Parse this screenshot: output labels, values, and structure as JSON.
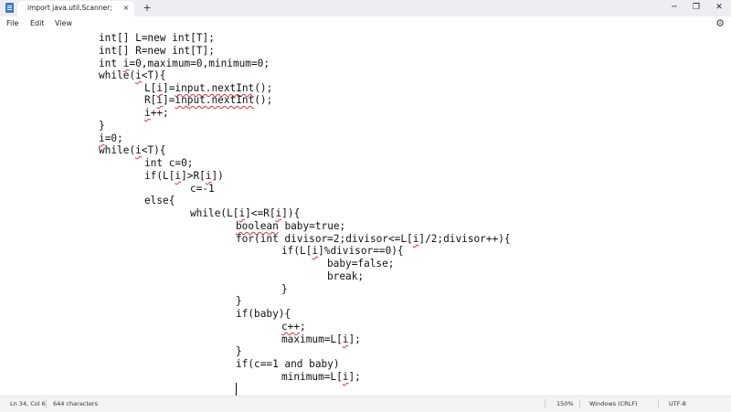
{
  "window": {
    "tab_title": "import java.util.Scanner;",
    "tab_close": "×",
    "new_tab": "+",
    "minimize": "─",
    "maximize": "❐",
    "close": "✕"
  },
  "menu": {
    "file": "File",
    "edit": "Edit",
    "view": "View",
    "settings_icon": "⚙"
  },
  "editor": {
    "lines": [
      "int[] L=new int[T];",
      "int[] R=new int[T];",
      "int i=0,maximum=0,minimum=0;",
      "while(i<T){",
      "L[i]=input.nextInt();",
      "R[i]=input.nextInt();",
      "i++;",
      "}",
      "i=0;",
      "while(i<T){",
      "int c=0;",
      "if(L[i]>R[i])",
      "c=-1",
      "else{",
      "while(L[i]<=R[i]){",
      "boolean baby=true;",
      "for(int divisor=2;divisor<=L[i]/2;divisor++){",
      "if(L[i]%divisor==0){",
      "baby=false;",
      "break;",
      "}",
      "}",
      "if(baby){",
      "c++;",
      "maximum=L[i];",
      "}",
      "if(c==1 and baby)",
      "minimum=L[i];"
    ]
  },
  "status": {
    "position": "Ln 34, Col 6",
    "chars": "644 characters",
    "zoom": "150%",
    "line_ending": "Windows (CRLF)",
    "encoding": "UTF-8"
  }
}
